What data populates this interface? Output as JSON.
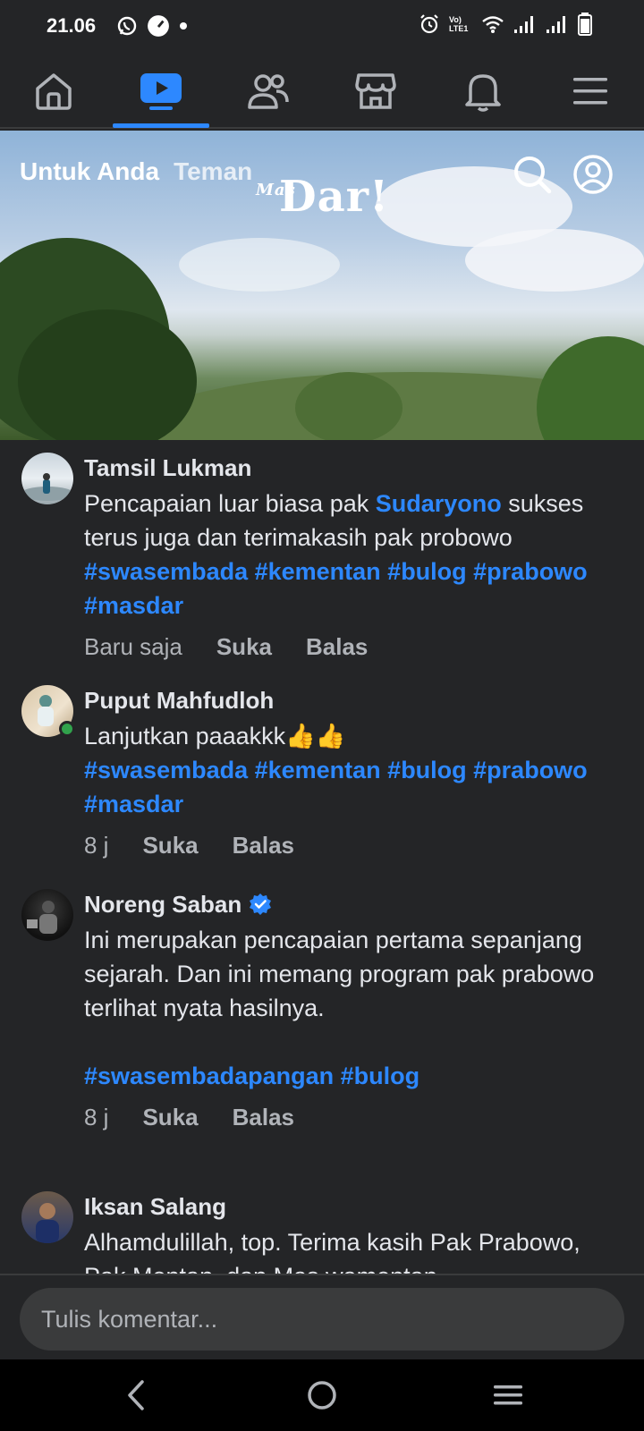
{
  "status_bar": {
    "time": "21.06",
    "left_icons": [
      "whatsapp-icon",
      "speed-icon",
      "dot-icon"
    ],
    "right_icons": [
      "alarm-icon",
      "volte-icon",
      "wifi-icon",
      "signal-icon",
      "signal-icon",
      "battery-icon"
    ],
    "volte_label": "Vo) LTE1"
  },
  "top_nav": {
    "tabs": [
      {
        "name": "home",
        "icon": "home-icon",
        "active": false
      },
      {
        "name": "video",
        "icon": "video-icon",
        "active": true
      },
      {
        "name": "friends",
        "icon": "friends-icon",
        "active": false
      },
      {
        "name": "marketplace",
        "icon": "marketplace-icon",
        "active": false
      },
      {
        "name": "notifications",
        "icon": "bell-icon",
        "active": false
      },
      {
        "name": "menu",
        "icon": "menu-icon",
        "active": false
      }
    ],
    "accent": "#2d88ff"
  },
  "video": {
    "tabs": [
      "Untuk Anda",
      "Teman"
    ],
    "watermark_small": "Mas",
    "watermark_big": "Dar!"
  },
  "comments": [
    {
      "author": "Tamsil Lukman",
      "verified": false,
      "online": false,
      "text_parts": [
        "Pencapaian luar biasa pak ",
        "Sudaryono",
        " sukses terus juga dan terimakasih pak probowo ",
        "#swasembada #kementan #bulog #prabowo #masdar"
      ],
      "time": "Baru saja",
      "like": "Suka",
      "reply": "Balas"
    },
    {
      "author": "Puput Mahfudloh",
      "verified": false,
      "online": true,
      "text": "Lanjutkan paaakkk👍👍",
      "hashtags": "#swasembada #kementan #bulog #prabowo #masdar",
      "time": "8 j",
      "like": "Suka",
      "reply": "Balas"
    },
    {
      "author": "Noreng Saban",
      "verified": true,
      "online": false,
      "text": "Ini merupakan pencapaian pertama sepanjang sejarah. Dan ini memang program pak prabowo terlihat nyata hasilnya.",
      "hashtags": "#swasembadapangan #bulog",
      "time": "8 j",
      "like": "Suka",
      "reply": "Balas"
    },
    {
      "author": "Iksan Salang",
      "verified": false,
      "online": false,
      "text": "Alhamdulillah, top. Terima kasih Pak Prabowo, Pak Mentan, dan Mas wamentan"
    }
  ],
  "composer": {
    "placeholder": "Tulis komentar..."
  },
  "android_nav": {
    "buttons": [
      "back-icon",
      "home-circle-icon",
      "recents-icon"
    ]
  }
}
